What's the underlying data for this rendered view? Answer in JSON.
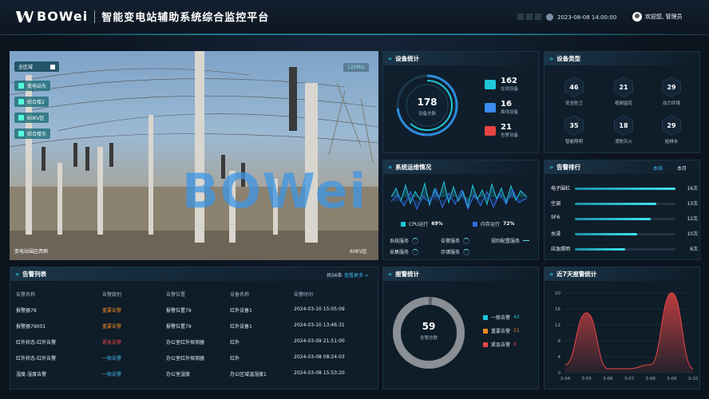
{
  "header": {
    "brand": "BOWei",
    "title": "智能变电站辅助系统综合监控平台",
    "datetime": "2023-08-08 14:00:00",
    "welcome": "欢迎您, 管理员"
  },
  "video": {
    "area_all": "全区域",
    "layers": [
      "变电站东",
      "综合楼2",
      "60KV区",
      "综合楼东"
    ],
    "badge": "120M/s",
    "watermark": "BOWei",
    "cap_left": "变电站围区西侧",
    "cap_right": "60KV区"
  },
  "device_stats": {
    "title": "设备统计",
    "total": "178",
    "total_label": "设备总数",
    "items": [
      {
        "value": "162",
        "label": "在线设备",
        "color": "#1fc7d8"
      },
      {
        "value": "16",
        "label": "离线设备",
        "color": "#3b8df0"
      },
      {
        "value": "21",
        "label": "告警设备",
        "color": "#e84545"
      }
    ]
  },
  "device_types": {
    "title": "设备类型",
    "items": [
      {
        "value": "46",
        "label": "安全防卫"
      },
      {
        "value": "21",
        "label": "视频监控"
      },
      {
        "value": "29",
        "label": "动力环境"
      },
      {
        "value": "35",
        "label": "智能照明"
      },
      {
        "value": "18",
        "label": "消防灭火"
      },
      {
        "value": "29",
        "label": "给排水"
      }
    ]
  },
  "system_status": {
    "title": "系统运维情况",
    "cpu_label": "CPU运行",
    "cpu_value": "69%",
    "mem_label": "内存运行",
    "mem_value": "72%",
    "services": [
      "系统服务",
      "告警服务",
      "规则配置服务",
      "采集服务",
      "存储服务"
    ]
  },
  "alarm_rank": {
    "title": "告警排行",
    "tab_week": "本周",
    "tab_month": "本月",
    "items": [
      {
        "name": "电子围栏",
        "value": "16次",
        "ratio": 1.0
      },
      {
        "name": "空调",
        "value": "13次",
        "ratio": 0.81
      },
      {
        "name": "SF6",
        "value": "12次",
        "ratio": 0.75
      },
      {
        "name": "水浸",
        "value": "10次",
        "ratio": 0.62
      },
      {
        "name": "应急照明",
        "value": "8次",
        "ratio": 0.5
      }
    ]
  },
  "alarm_list": {
    "title": "告警列表",
    "count": "共56条",
    "more": "查看更多 >",
    "headers": [
      "告警名称",
      "告警级别",
      "告警位置",
      "设备名称",
      "告警时间"
    ],
    "rows": [
      [
        "报警器79",
        "重要告警",
        "报警位置79",
        "红外设备1",
        "2024-03-10 15:05:09"
      ],
      [
        "报警器79001",
        "重要告警",
        "报警位置79",
        "红外设备1",
        "2024-03-10 13:46:31"
      ],
      [
        "红外状态-红外告警",
        "紧急告警",
        "办公室红外探测器",
        "红外",
        "2024-03-09 21:51:00"
      ],
      [
        "红外状态-红外告警",
        "一般告警",
        "办公室红外探测器",
        "红外",
        "2024-03-08 08:24:03"
      ],
      [
        "湿度-湿度告警",
        "一般告警",
        "办公室湿度",
        "办公区域温湿度1",
        "2024-03-08 15:53:20"
      ]
    ],
    "level_colors": {
      "重要告警": "#f08a24",
      "紧急告警": "#e84545",
      "一般告警": "#3fb6f0"
    }
  },
  "alarm_stats": {
    "title": "报警统计",
    "total": "59",
    "total_label": "告警总数",
    "items": [
      {
        "label": "一般告警",
        "value": "42",
        "color": "#1fc7d8"
      },
      {
        "label": "重要告警",
        "value": "11",
        "color": "#f08a24"
      },
      {
        "label": "紧急告警",
        "value": "6",
        "color": "#e84545"
      }
    ]
  },
  "chart_data": {
    "type": "area",
    "title": "近7天报警统计",
    "categories": [
      "3-04",
      "3-05",
      "3-06",
      "3-07",
      "3-08",
      "3-09",
      "3-10"
    ],
    "values": [
      2,
      15,
      1,
      1,
      2,
      20,
      1
    ],
    "ylim": [
      0,
      20
    ],
    "yticks": [
      0,
      4,
      8,
      12,
      16,
      20
    ],
    "color": "#e84545"
  }
}
